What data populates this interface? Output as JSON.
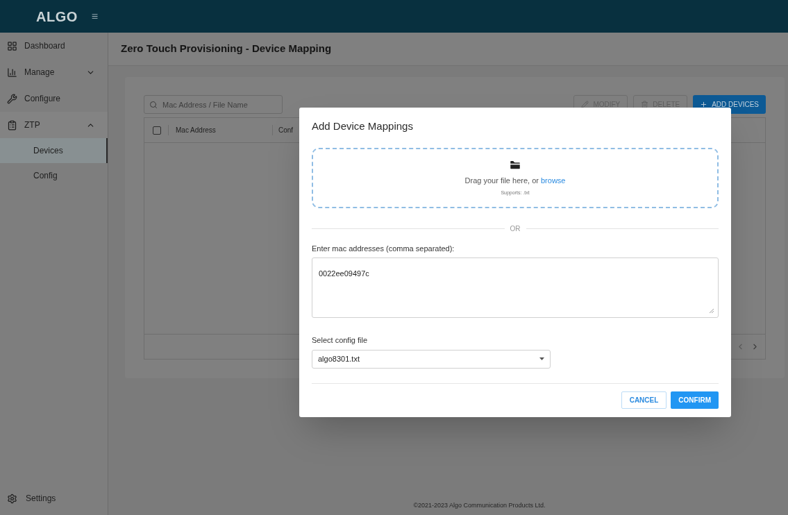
{
  "brand": "ALGO",
  "menu_glyph": "≡",
  "sidebar": {
    "items": [
      {
        "label": "Dashboard"
      },
      {
        "label": "Manage",
        "expanded": false
      },
      {
        "label": "Configure"
      },
      {
        "label": "ZTP",
        "expanded": true,
        "children": [
          {
            "label": "Devices",
            "selected": true
          },
          {
            "label": "Config",
            "selected": false
          }
        ]
      }
    ],
    "footer": {
      "label": "Settings"
    }
  },
  "page_title": "Zero Touch Provisioning - Device Mapping",
  "search": {
    "placeholder": "Mac Address / File Name"
  },
  "toolbar": [
    {
      "label": "MODIFY",
      "kind": "edit",
      "disabled": true
    },
    {
      "label": "DELETE",
      "kind": "delete",
      "disabled": true
    },
    {
      "label": "ADD DEVICES",
      "kind": "add",
      "disabled": false
    }
  ],
  "table": {
    "columns": [
      "Mac Address",
      "Conf"
    ],
    "select_all_checked": false
  },
  "copyright": "©2021-2023 Algo Communication Products Ltd.",
  "dialog": {
    "title": "Add Device Mappings",
    "dropzone": {
      "link": "browse",
      "prompt": "Drag your file here, or ",
      "hint": "Supports: .txt"
    },
    "divider": "OR",
    "mac_label": "Enter mac addresses (comma separated):",
    "mac_value": "0022ee09497c",
    "config_label": "Select config file",
    "config_value": "algo8301.txt",
    "buttons": [
      {
        "label": "CANCEL",
        "kind": "outlined"
      },
      {
        "label": "CONFIRM",
        "kind": "primary"
      }
    ]
  }
}
